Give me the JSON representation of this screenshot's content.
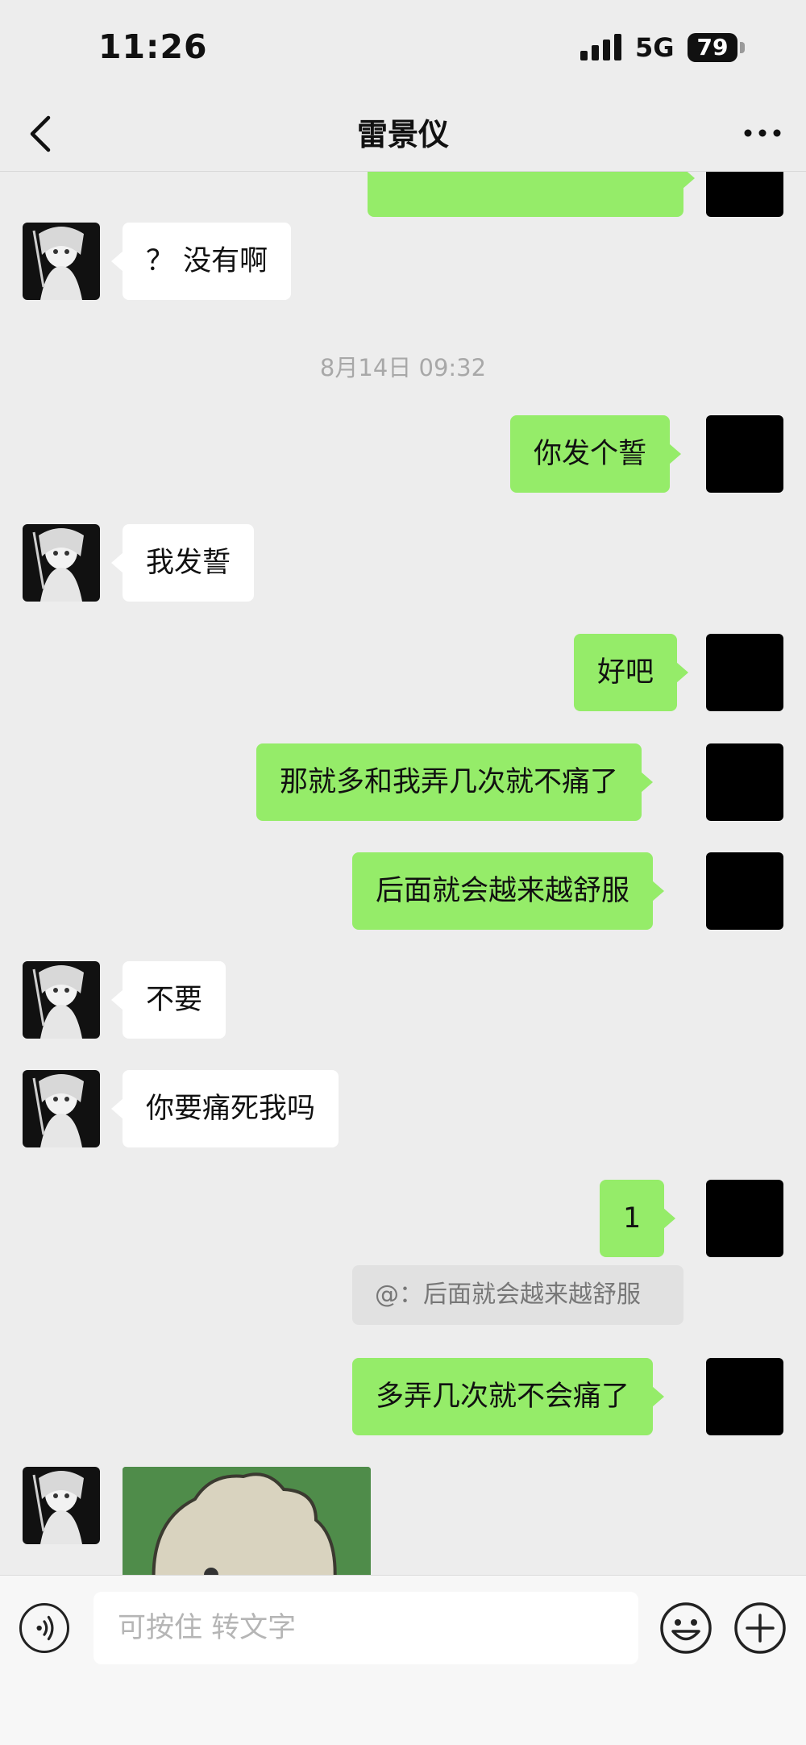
{
  "status_bar": {
    "time": "11:26",
    "network": "5G",
    "battery": "79"
  },
  "nav": {
    "title": "雷景仪"
  },
  "messages": [
    {
      "from": "me",
      "text": ""
    },
    {
      "from": "them",
      "text": "？ 没有啊"
    },
    {
      "type": "timestamp",
      "text": "8月14日 09:32"
    },
    {
      "from": "me",
      "text": "你发个誓"
    },
    {
      "from": "them",
      "text": "我发誓"
    },
    {
      "from": "me",
      "text": "好吧"
    },
    {
      "from": "me",
      "text": "那就多和我弄几次就不痛了"
    },
    {
      "from": "me",
      "text": "后面就会越来越舒服"
    },
    {
      "from": "them",
      "text": "不要"
    },
    {
      "from": "them",
      "text": "你要痛死我吗"
    },
    {
      "from": "me",
      "text": "1",
      "quote": "@：后面就会越来越舒服"
    },
    {
      "from": "me",
      "text": "多弄几次就不会痛了"
    },
    {
      "from": "them",
      "type": "sticker",
      "icon": "bear-sticker"
    }
  ],
  "input": {
    "placeholder": "可按住 转文字"
  },
  "icons": {
    "back": "chevron-left-icon",
    "more": "more-dots-icon",
    "voice": "voice-icon",
    "emoji": "emoji-icon",
    "plus": "plus-icon"
  },
  "colors": {
    "my_bubble": "#95ec69",
    "their_bubble": "#ffffff",
    "background": "#ededed"
  }
}
